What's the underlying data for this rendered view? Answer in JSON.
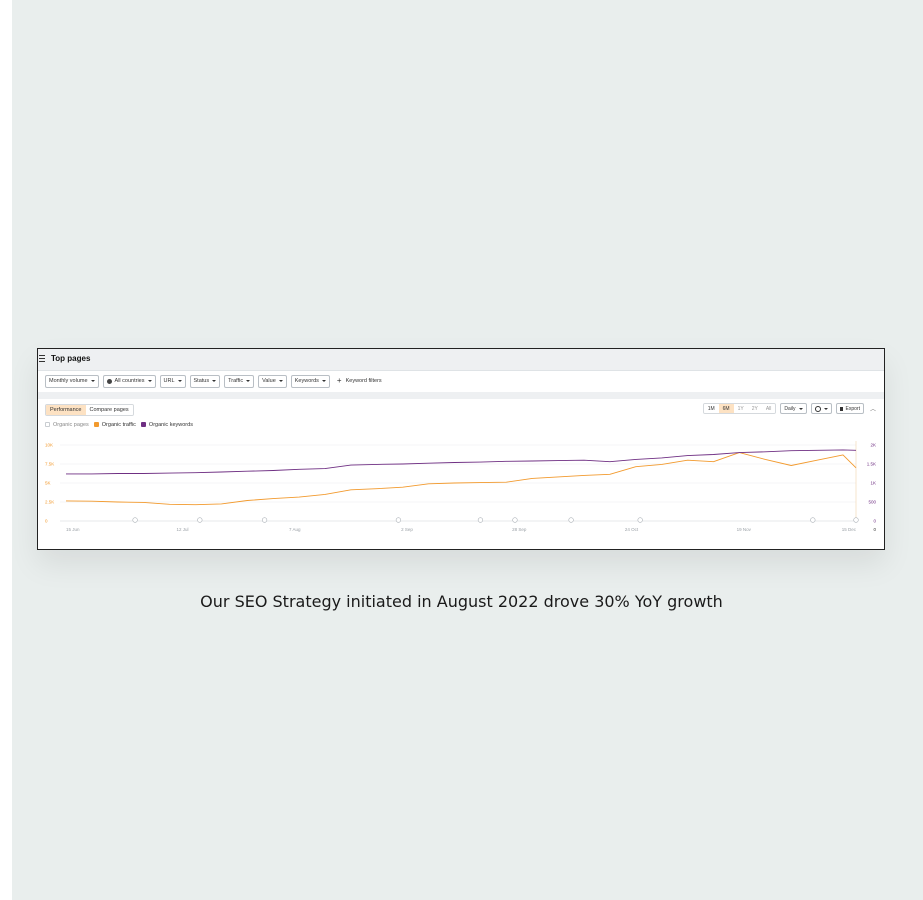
{
  "window": {
    "title": "Top pages"
  },
  "filters": [
    {
      "label": "Monthly volume"
    },
    {
      "label": "All countries"
    },
    {
      "label": "URL"
    },
    {
      "label": "Status"
    },
    {
      "label": "Traffic"
    },
    {
      "label": "Value"
    },
    {
      "label": "Keywords"
    }
  ],
  "keyword_filters_label": "Keyword filters",
  "tabs": [
    {
      "label": "Performance"
    },
    {
      "label": "Compare pages"
    }
  ],
  "periods": [
    "1M",
    "6M",
    "1Y",
    "2Y",
    "All"
  ],
  "active_period": "6M",
  "interval_label": "Daily",
  "export_label": "Export",
  "legend": [
    {
      "label": "Organic pages",
      "checked": false
    },
    {
      "label": "Organic traffic",
      "checked": true,
      "color": "#f29a2e"
    },
    {
      "label": "Organic keywords",
      "checked": true,
      "color": "#6f2f83"
    }
  ],
  "caption": "Our SEO Strategy initiated in August 2022 drove 30% YoY growth",
  "colors": {
    "traffic": "#f29a2e",
    "keywords": "#6f2f83",
    "active_tab": "#fde2c3",
    "background": "#e9eeed"
  },
  "chart_data": {
    "type": "line",
    "x_ticks": [
      "15 Jun",
      "12 Jul",
      "7 Aug",
      "2 Sep",
      "28 Sep",
      "24 Oct",
      "19 Nov",
      "15 Dec"
    ],
    "y_left_ticks": [
      "0",
      "2.5K",
      "5K",
      "7.5K",
      "10K"
    ],
    "y_right_ticks": [
      "0",
      "500",
      "1K",
      "1.5K",
      "2K"
    ],
    "y_left_range": [
      0,
      10000
    ],
    "y_right_range": [
      0,
      2000
    ],
    "series": [
      {
        "name": "Organic traffic",
        "axis": "left",
        "color": "#f29a2e",
        "x": [
          "2022-06-15",
          "2022-06-21",
          "2022-06-27",
          "2022-07-03",
          "2022-07-09",
          "2022-07-15",
          "2022-07-21",
          "2022-07-27",
          "2022-08-02",
          "2022-08-08",
          "2022-08-14",
          "2022-08-20",
          "2022-08-26",
          "2022-09-01",
          "2022-09-07",
          "2022-09-13",
          "2022-09-19",
          "2022-09-25",
          "2022-10-01",
          "2022-10-07",
          "2022-10-13",
          "2022-10-19",
          "2022-10-25",
          "2022-10-31",
          "2022-11-06",
          "2022-11-12",
          "2022-11-18",
          "2022-11-24",
          "2022-11-30",
          "2022-12-06",
          "2022-12-12",
          "2022-12-15"
        ],
        "values": [
          2650,
          2600,
          2500,
          2450,
          2200,
          2150,
          2250,
          2700,
          2950,
          3150,
          3500,
          4100,
          4250,
          4450,
          4900,
          5000,
          5050,
          5100,
          5600,
          5800,
          6000,
          6150,
          7150,
          7450,
          8000,
          7800,
          9000,
          8100,
          7300,
          8000,
          8700,
          7000
        ]
      },
      {
        "name": "Organic keywords",
        "axis": "right",
        "color": "#6f2f83",
        "x": [
          "2022-06-15",
          "2022-06-21",
          "2022-06-27",
          "2022-07-03",
          "2022-07-09",
          "2022-07-15",
          "2022-07-21",
          "2022-07-27",
          "2022-08-02",
          "2022-08-08",
          "2022-08-14",
          "2022-08-20",
          "2022-08-26",
          "2022-09-01",
          "2022-09-07",
          "2022-09-13",
          "2022-09-19",
          "2022-09-25",
          "2022-10-01",
          "2022-10-07",
          "2022-10-13",
          "2022-10-19",
          "2022-10-25",
          "2022-10-31",
          "2022-11-06",
          "2022-11-12",
          "2022-11-18",
          "2022-11-24",
          "2022-11-30",
          "2022-12-06",
          "2022-12-12",
          "2022-12-15"
        ],
        "values": [
          1240,
          1240,
          1250,
          1250,
          1260,
          1270,
          1290,
          1310,
          1330,
          1360,
          1380,
          1470,
          1490,
          1500,
          1520,
          1540,
          1550,
          1570,
          1580,
          1590,
          1600,
          1560,
          1620,
          1660,
          1720,
          1750,
          1800,
          1820,
          1850,
          1860,
          1870,
          1860
        ]
      }
    ],
    "event_markers": [
      "2022-07-01",
      "2022-07-16",
      "2022-07-31",
      "2022-08-31",
      "2022-09-19",
      "2022-09-27",
      "2022-10-10",
      "2022-10-26",
      "2022-12-05",
      "2022-12-15"
    ],
    "grid": true
  }
}
